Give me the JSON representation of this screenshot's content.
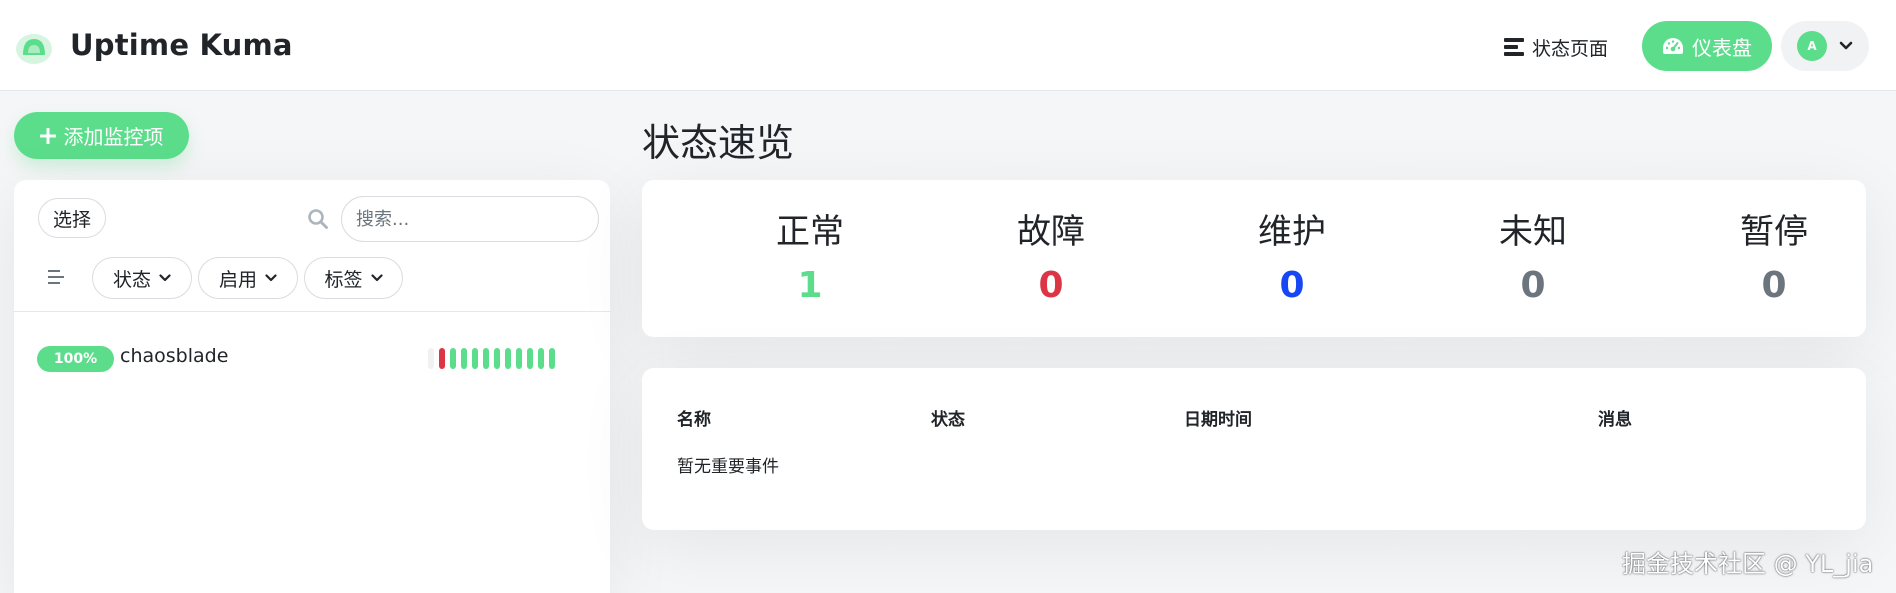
{
  "header": {
    "app_title": "Uptime Kuma",
    "status_page_label": "状态页面",
    "dashboard_label": "仪表盘",
    "avatar_initial": "A"
  },
  "sidebar": {
    "add_monitor_label": "添加监控项",
    "select_label": "选择",
    "search_placeholder": "搜索...",
    "filters": [
      "状态",
      "启用",
      "标签"
    ],
    "monitors": [
      {
        "uptime": "100%",
        "name": "chaosblade",
        "heartbeats": [
          "empty",
          "down",
          "up",
          "up",
          "up",
          "up",
          "up",
          "up",
          "up",
          "up",
          "up",
          "up"
        ]
      }
    ]
  },
  "main": {
    "title": "状态速览",
    "stats": [
      {
        "label": "正常",
        "value": "1",
        "color": "#5cdd8b"
      },
      {
        "label": "故障",
        "value": "0",
        "color": "#dc3545"
      },
      {
        "label": "维护",
        "value": "0",
        "color": "#1747f5"
      },
      {
        "label": "未知",
        "value": "0",
        "color": "#6c757d"
      },
      {
        "label": "暂停",
        "value": "0",
        "color": "#6c757d"
      }
    ],
    "events_table": {
      "columns": [
        "名称",
        "状态",
        "日期时间",
        "消息"
      ],
      "empty_message": "暂无重要事件"
    }
  },
  "watermark": "掘金技术社区 @ YL_jia",
  "colors": {
    "primary": "#5cdd8b",
    "down": "#dc3545",
    "maintenance": "#1747f5",
    "muted": "#6c757d"
  }
}
